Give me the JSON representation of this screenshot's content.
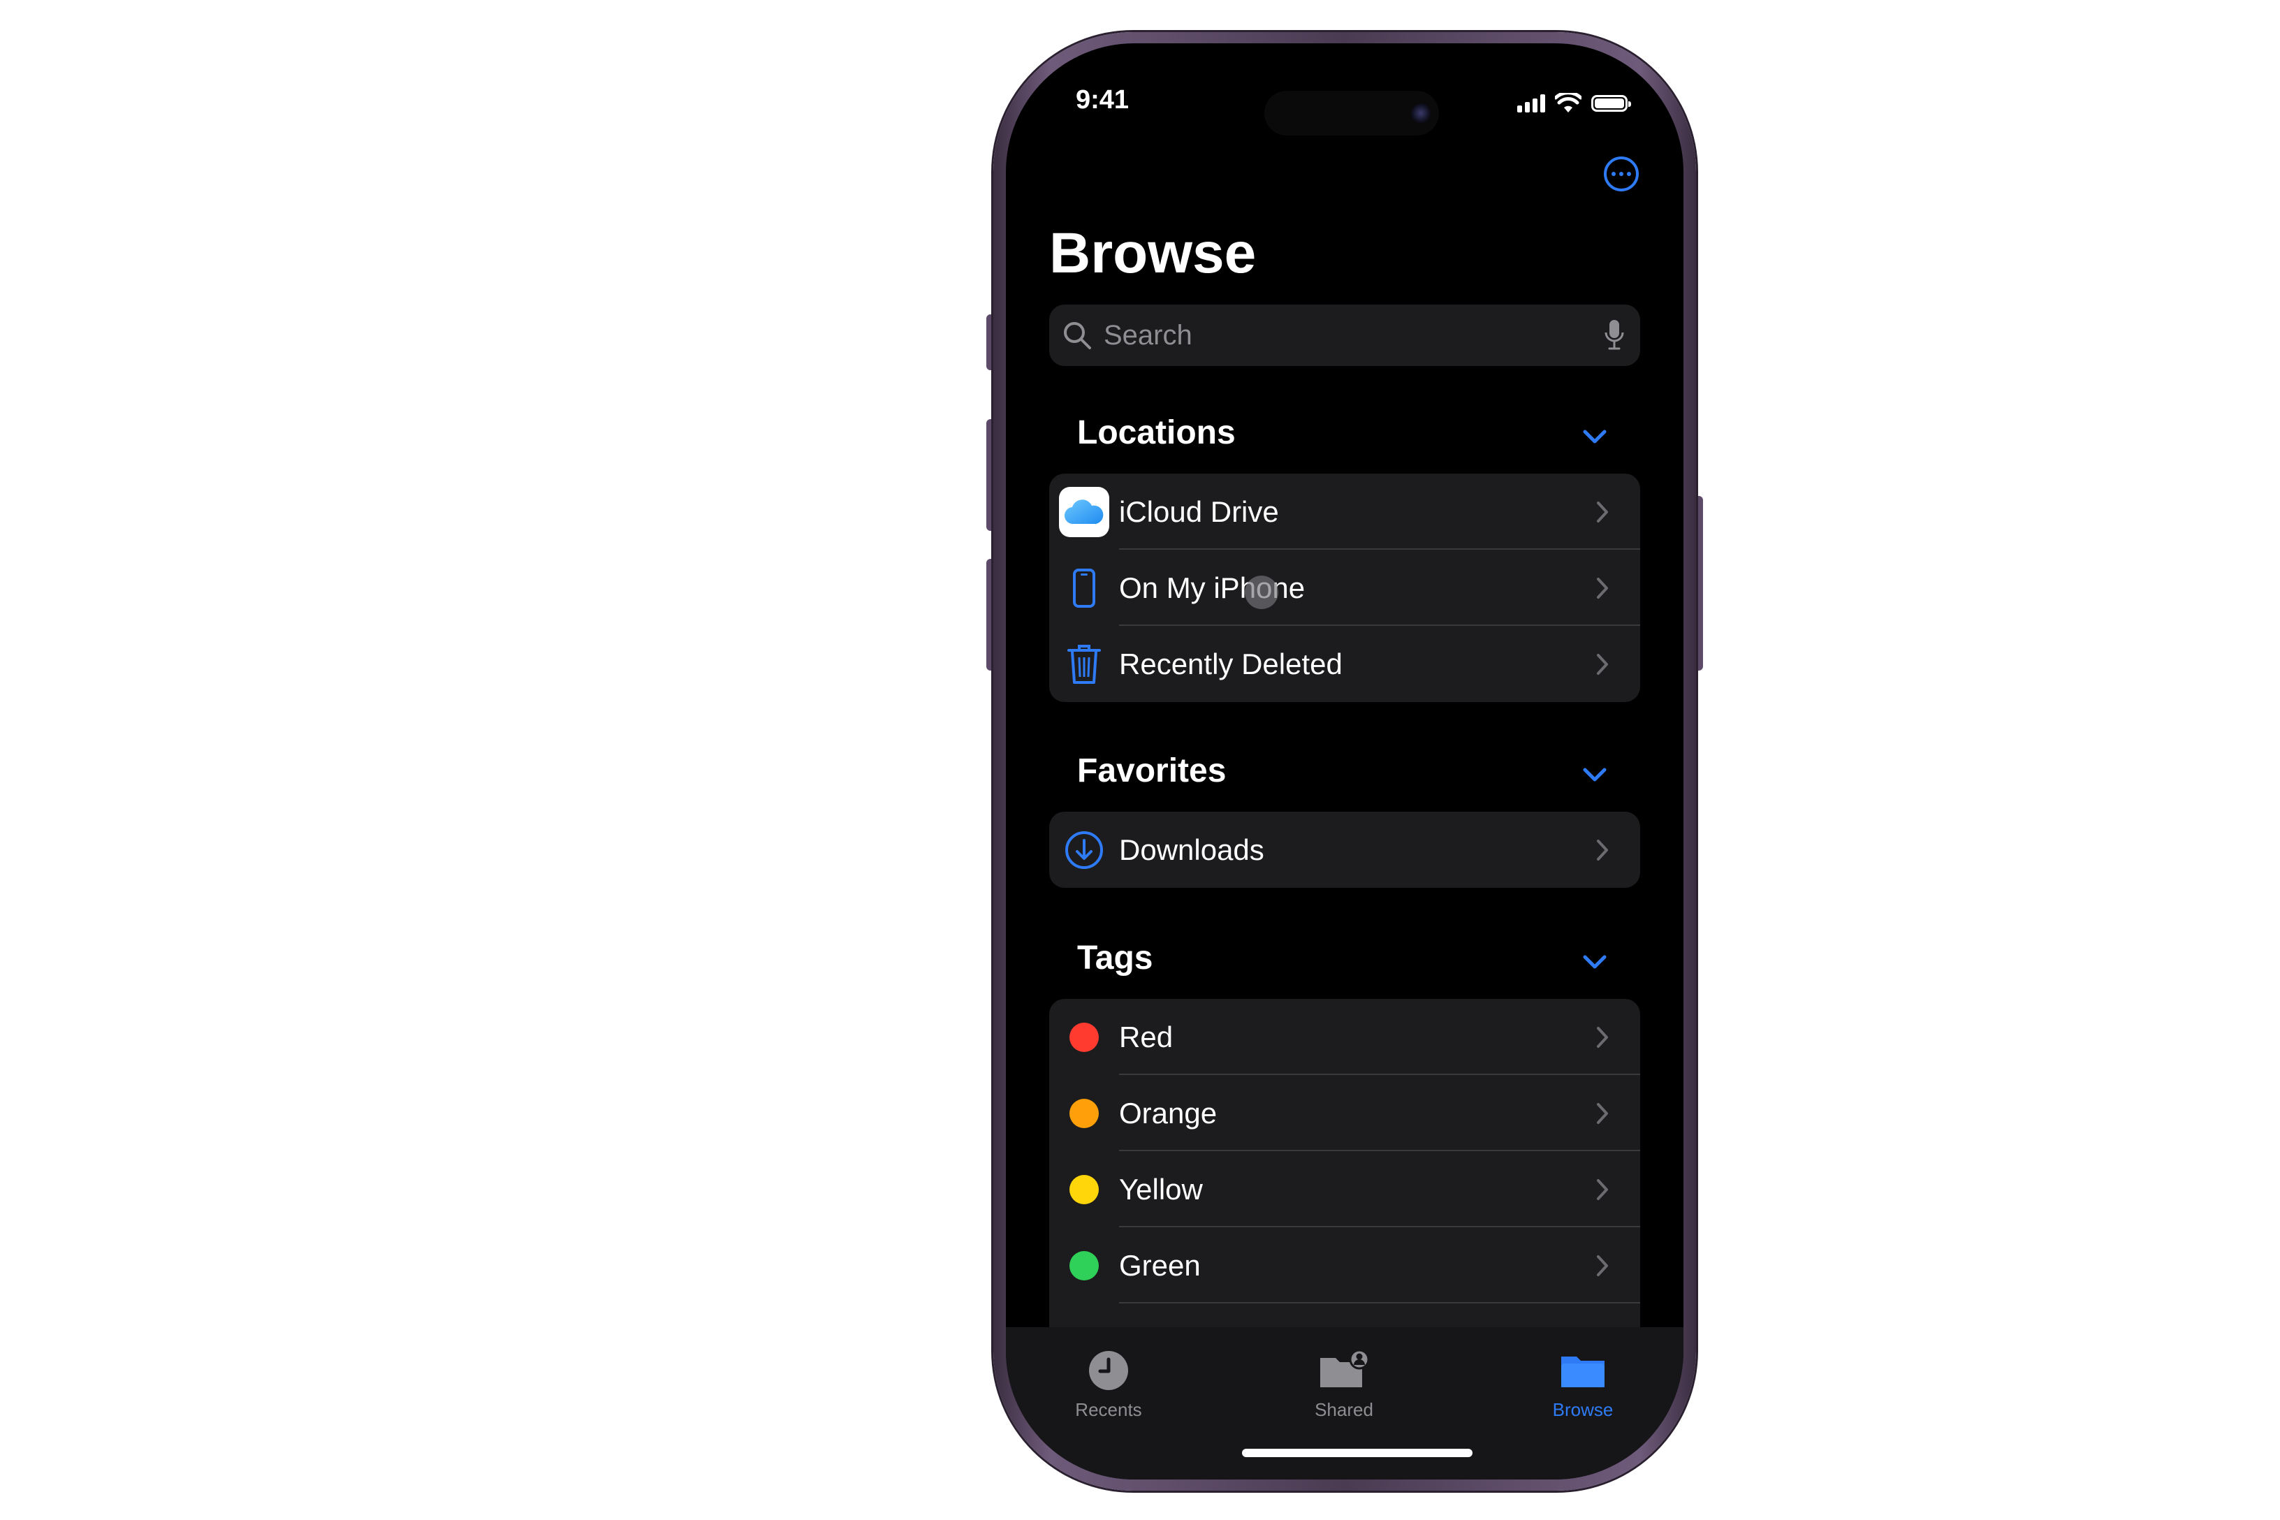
{
  "status": {
    "time": "9:41"
  },
  "header": {
    "title": "Browse"
  },
  "search": {
    "placeholder": "Search"
  },
  "sections": {
    "locations": {
      "title": "Locations",
      "items": [
        {
          "label": "iCloud Drive",
          "icon": "icloud-icon"
        },
        {
          "label": "On My iPhone",
          "icon": "iphone-icon"
        },
        {
          "label": "Recently Deleted",
          "icon": "trash-icon"
        }
      ]
    },
    "favorites": {
      "title": "Favorites",
      "items": [
        {
          "label": "Downloads",
          "icon": "download-icon"
        }
      ]
    },
    "tags": {
      "title": "Tags",
      "items": [
        {
          "label": "Red",
          "color": "#ff3b30"
        },
        {
          "label": "Orange",
          "color": "#ff9f0a"
        },
        {
          "label": "Yellow",
          "color": "#ffd60a"
        },
        {
          "label": "Green",
          "color": "#30d158"
        }
      ]
    }
  },
  "tabbar": {
    "recents": "Recents",
    "shared": "Shared",
    "browse": "Browse",
    "active": "Browse"
  },
  "colors": {
    "accent": "#2f7bf5",
    "background": "#000000",
    "cell": "#1c1c1e"
  }
}
